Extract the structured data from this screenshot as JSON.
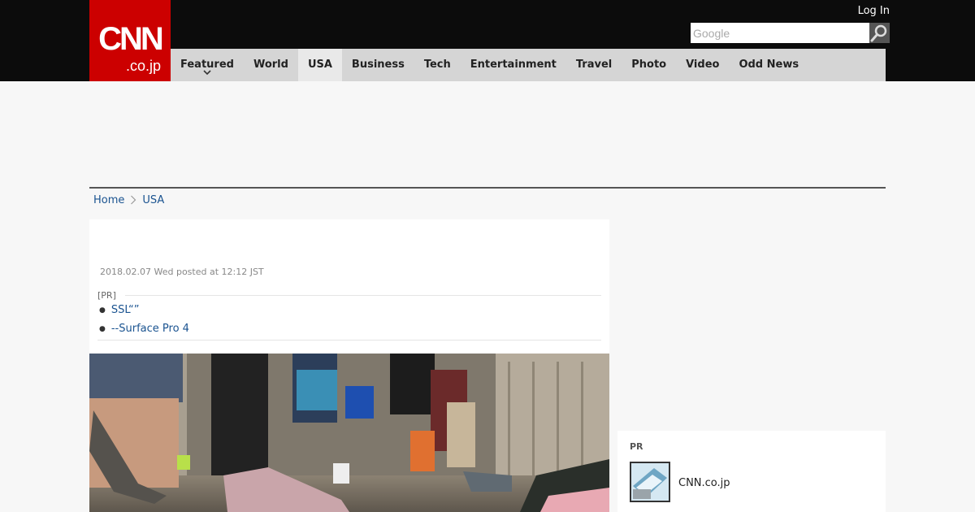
{
  "header": {
    "logo_main": "CNN",
    "logo_tld": ".co.jp",
    "login_label": "Log In",
    "search_placeholder": "Google"
  },
  "nav": {
    "items": [
      {
        "label": "Featured",
        "has_dropdown": true
      },
      {
        "label": "World"
      },
      {
        "label": "USA",
        "active": true
      },
      {
        "label": "Business"
      },
      {
        "label": "Tech"
      },
      {
        "label": "Entertainment"
      },
      {
        "label": "Travel"
      },
      {
        "label": "Photo"
      },
      {
        "label": "Video"
      },
      {
        "label": "Odd News"
      }
    ]
  },
  "breadcrumb": {
    "home": "Home",
    "current": "USA"
  },
  "article": {
    "date": "2018.02.07 Wed posted at 12:12 JST",
    "pr_label": "[PR]",
    "pr_links": [
      "SSL“”",
      "--Surface Pro 4"
    ]
  },
  "sidebar": {
    "pr_label": "PR",
    "item_title": "CNN.co.jp"
  },
  "colors": {
    "brand_red": "#cc0000",
    "topbar": "#0c0c0c",
    "nav_bg": "#d5d5d5",
    "link": "#1a5390"
  }
}
